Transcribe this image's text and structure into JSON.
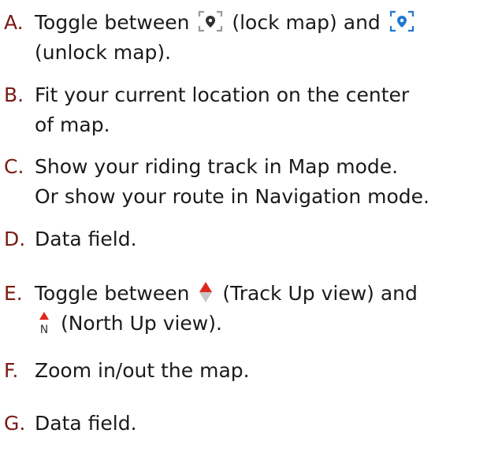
{
  "items": [
    {
      "letter": "A.",
      "text_before": "Toggle between",
      "text_middle": "(lock map) and",
      "text_end": "(unlock map).",
      "icons": [
        "lock-map-icon",
        "unlock-map-icon"
      ]
    },
    {
      "letter": "B.",
      "line1": "Fit your current location on the center",
      "line2": "of map."
    },
    {
      "letter": "C.",
      "line1": "Show your riding track in Map mode.",
      "line2": "Or show your route in Navigation mode."
    },
    {
      "letter": "D.",
      "line1": "Data field."
    },
    {
      "letter": "E.",
      "text_before": "Toggle between",
      "text_middle": "(Track Up view) and",
      "text_end": "(North Up view).",
      "north_label": "N",
      "icons": [
        "track-up-icon",
        "north-up-icon"
      ]
    },
    {
      "letter": "F.",
      "line1": "Zoom in/out the map."
    },
    {
      "letter": "G.",
      "line1": "Data field."
    }
  ],
  "colors": {
    "letter": "#7a1a14",
    "text": "#1a1a1a",
    "lock_icon": "#333333",
    "unlock_icon": "#1f78d1",
    "arrow_up": "#e0261c",
    "arrow_down": "#c8c8c8"
  }
}
